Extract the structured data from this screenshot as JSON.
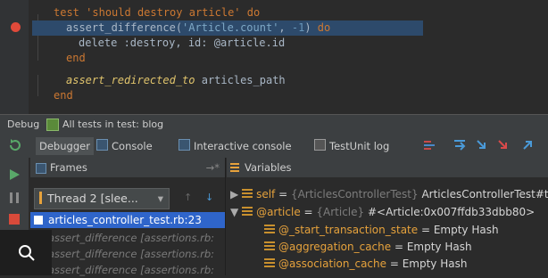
{
  "editor": {
    "lines": [
      {
        "kw": "test",
        "rest_str": "'should destroy article'",
        "kw2": "do"
      },
      {
        "fn": "assert_difference(",
        "str": "'Article.count'",
        "sep": ", ",
        "num": "-1",
        "close": ")",
        "kw": "do"
      },
      {
        "text": "delete :destroy, id: @article.id"
      },
      {
        "kw": "end"
      },
      {
        "fn": "assert_redirected_to",
        "arg": " articles_path"
      },
      {
        "kw": "end"
      }
    ]
  },
  "debugbar": {
    "label": "Debug",
    "config": "All tests in test: blog"
  },
  "toolbar": {
    "tabs": [
      "Debugger",
      "Console",
      "Interactive console",
      "TestUnit log"
    ],
    "tab_suffix": "→*"
  },
  "frames": {
    "header": "Frames",
    "thread": "Thread 2 [slee...",
    "selected": "articles_controller_test.rb:23",
    "rows": [
      "assert_difference [assertions.rb:",
      "assert_difference [assertions.rb:",
      "assert_difference [assertions.rb:"
    ]
  },
  "variables": {
    "header": "Variables",
    "rows": [
      {
        "name": "self",
        "eq": " = ",
        "type": "{ArticlesControllerTest}",
        "value": " ArticlesControllerTest#te"
      },
      {
        "name": "@article",
        "eq": " = ",
        "type": "{Article}",
        "value": " #<Article:0x007ffdb33dbb80>"
      },
      {
        "name": "@_start_transaction_state",
        "eq": " = ",
        "value": "Empty Hash"
      },
      {
        "name": "@aggregation_cache",
        "eq": " = ",
        "value": "Empty Hash"
      },
      {
        "name": "@association_cache",
        "eq": " = ",
        "value": "Empty Hash"
      }
    ]
  },
  "colors": {
    "breakpoint": "#e04a3a",
    "selection": "#2f65ca",
    "keyword": "#cc7832",
    "string": "#6a8759"
  },
  "icons": [
    "breakpoint-icon",
    "debug-icon",
    "console-icon",
    "step-over-icon",
    "step-into-icon",
    "resume-icon",
    "pause-icon",
    "stop-icon",
    "search-icon"
  ]
}
